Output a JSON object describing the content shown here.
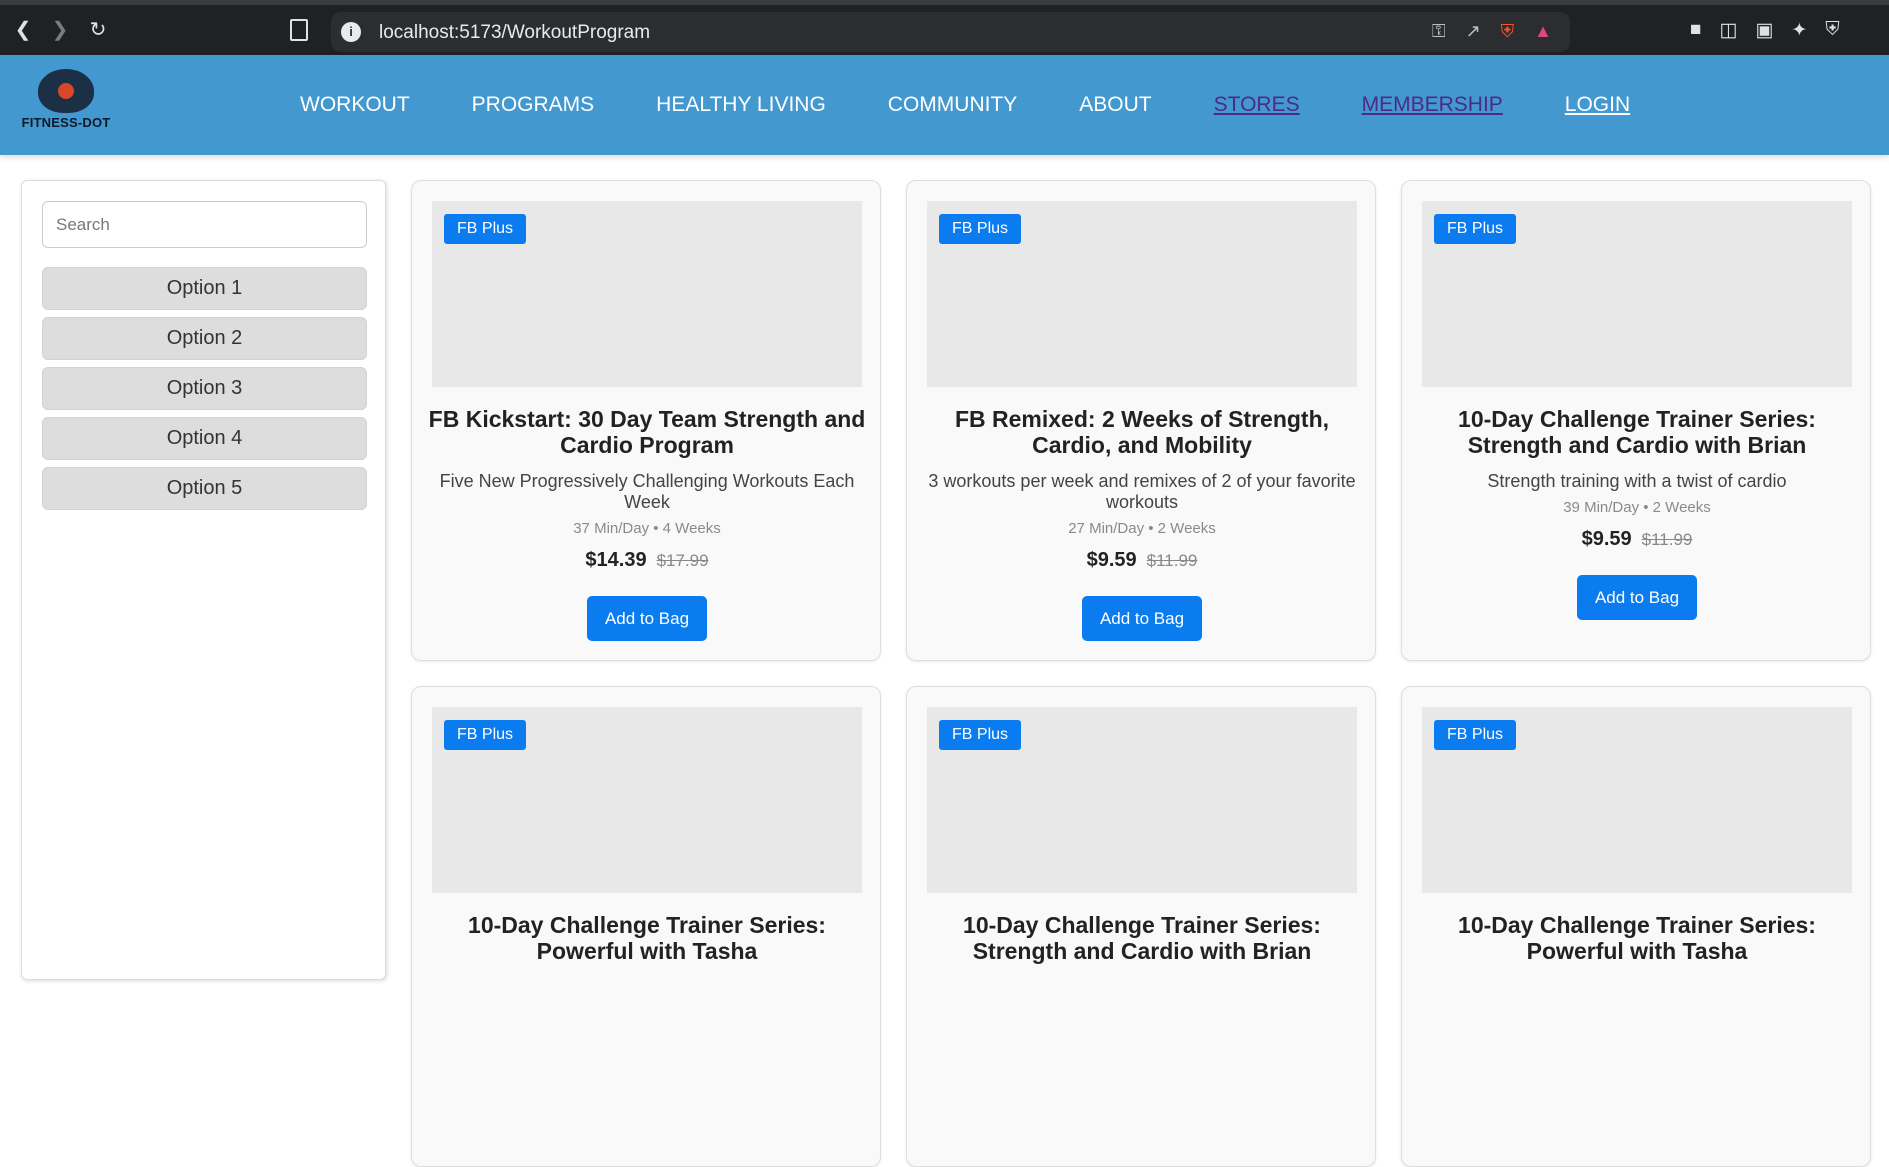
{
  "browser": {
    "url": "localhost:5173/WorkoutProgram"
  },
  "site": {
    "logo_text": "FITNESS-DOT",
    "nav": [
      {
        "label": "WORKOUT"
      },
      {
        "label": "PROGRAMS"
      },
      {
        "label": "HEALTHY LIVING"
      },
      {
        "label": "COMMUNITY"
      },
      {
        "label": "ABOUT"
      },
      {
        "label": "STORES"
      },
      {
        "label": "MEMBERSHIP"
      },
      {
        "label": "LOGIN"
      }
    ]
  },
  "sidebar": {
    "search_placeholder": "Search",
    "options": [
      {
        "label": "Option 1"
      },
      {
        "label": "Option 2"
      },
      {
        "label": "Option 3"
      },
      {
        "label": "Option 4"
      },
      {
        "label": "Option 5"
      }
    ]
  },
  "cards": [
    {
      "badge": "FB Plus",
      "title": "FB Kickstart: 30 Day Team Strength and Cardio Program",
      "description": "Five New Progressively Challenging Workouts Each Week",
      "meta": "37 Min/Day • 4 Weeks",
      "price": "$14.39",
      "old_price": "$17.99",
      "button": "Add to Bag"
    },
    {
      "badge": "FB Plus",
      "title": "FB Remixed: 2 Weeks of Strength, Cardio, and Mobility",
      "description": "3 workouts per week and remixes of 2 of your favorite workouts",
      "meta": "27 Min/Day • 2 Weeks",
      "price": "$9.59",
      "old_price": "$11.99",
      "button": "Add to Bag"
    },
    {
      "badge": "FB Plus",
      "title": "10-Day Challenge Trainer Series: Strength and Cardio with Brian",
      "description": "Strength training with a twist of cardio",
      "meta": "39 Min/Day • 2 Weeks",
      "price": "$9.59",
      "old_price": "$11.99",
      "button": "Add to Bag"
    },
    {
      "badge": "FB Plus",
      "title": "10-Day Challenge Trainer Series: Powerful with Tasha"
    },
    {
      "badge": "FB Plus",
      "title": "10-Day Challenge Trainer Series: Strength and Cardio with Brian"
    },
    {
      "badge": "FB Plus",
      "title": "10-Day Challenge Trainer Series: Powerful with Tasha"
    }
  ]
}
